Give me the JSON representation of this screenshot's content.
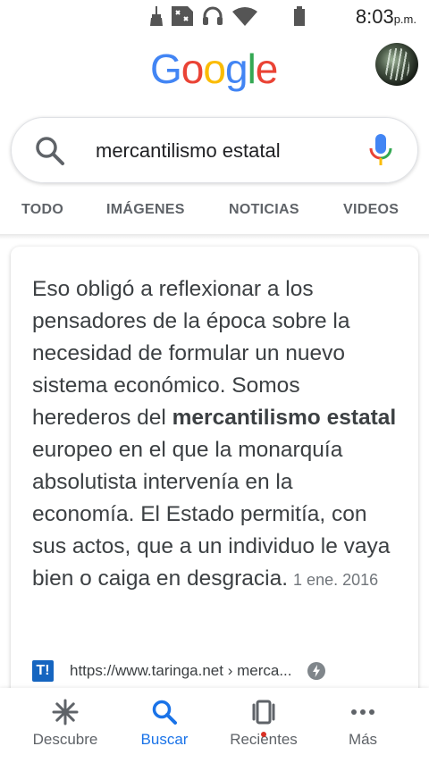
{
  "status_bar": {
    "time": "8:03",
    "ampm": "p.m.",
    "icons": [
      "cleaner-icon",
      "sim-card-icon",
      "headset-icon",
      "wifi-icon",
      "battery-icon"
    ]
  },
  "header": {
    "logo_letters": [
      "G",
      "o",
      "o",
      "g",
      "l",
      "e"
    ],
    "avatar": "profile-avatar"
  },
  "search": {
    "query": "mercantilismo estatal"
  },
  "tabs": [
    "TODO",
    "IMÁGENES",
    "NOTICIAS",
    "VIDEOS"
  ],
  "result": {
    "text_before": "Eso obligó a reflexionar a los pensadores de la época sobre la necesidad de formular un nuevo sistema económico. Somos herederos del ",
    "highlight": "mercantilismo estatal",
    "text_after": " europeo en el que la monarquía absolutista intervenía en la economía. El Estado permitía, con sus actos, que a un individuo le vaya bien o caiga en desgracia.",
    "date": "1 ene. 2016",
    "favicon_text": "T!",
    "source_url": "https://www.taringa.net › merca..."
  },
  "bottom_nav": {
    "items": [
      {
        "label": "Descubre",
        "icon": "asterisk-icon"
      },
      {
        "label": "Buscar",
        "icon": "search-icon"
      },
      {
        "label": "Recientes",
        "icon": "recents-icon"
      },
      {
        "label": "Más",
        "icon": "more-dots-icon"
      }
    ],
    "active": "Buscar"
  },
  "colors": {
    "google_blue": "#4285F4",
    "google_red": "#EA4335",
    "google_yellow": "#FBBC05",
    "google_green": "#34A853",
    "active_blue": "#1a73e8"
  }
}
